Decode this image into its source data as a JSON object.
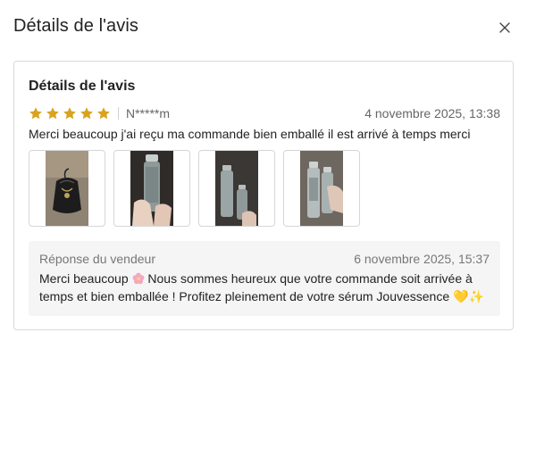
{
  "modal": {
    "title": "Détails de l'avis",
    "close_label": "×"
  },
  "review": {
    "section_title": "Détails de l'avis",
    "rating": 5,
    "reviewer": "N*****m",
    "date": "4 novembre 2025, 13:38",
    "text": "Merci beaucoup j'ai reçu ma commande bien emballé il est arrivé à temps merci",
    "photos": [
      {
        "subject": "black drawstring pouch"
      },
      {
        "subject": "serum bottle held in hand"
      },
      {
        "subject": "two serum bottles"
      },
      {
        "subject": "two serum bottles held in hand"
      }
    ]
  },
  "seller_reply": {
    "label": "Réponse du vendeur",
    "date": "6 novembre 2025, 15:37",
    "text_part1": "Merci beaucoup",
    "text_part2": " Nous sommes heureux que votre commande soit arrivée à temps et bien emballée ! Profitez pleinement de votre sérum Jouvessence 💛✨"
  },
  "colors": {
    "star": "#d8a31f",
    "border": "#d9d9d9",
    "reply_bg": "#f5f5f5"
  }
}
